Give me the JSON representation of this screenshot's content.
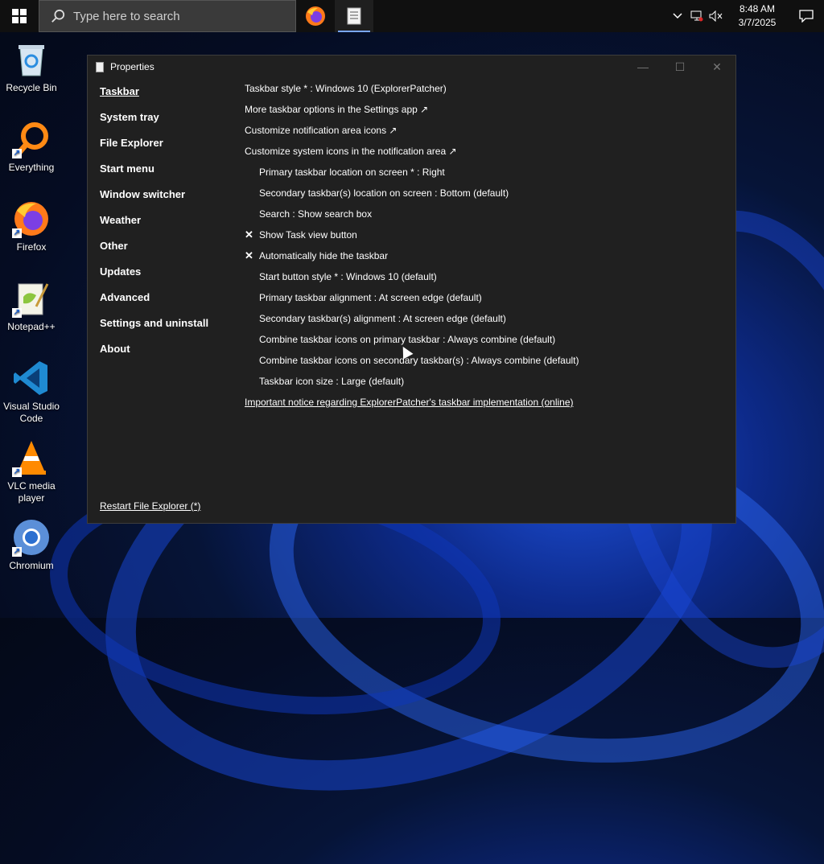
{
  "taskbar": {
    "search_placeholder": "Type here to search",
    "clock_time": "8:48 AM",
    "clock_date": "3/7/2025",
    "apps": [
      {
        "icon": "firefox-icon",
        "active": false
      },
      {
        "icon": "properties-app-icon",
        "active": true
      }
    ],
    "tray_icons": [
      "chevron-up-icon",
      "network-icon",
      "volume-muted-icon",
      "notification-icon"
    ]
  },
  "desktop": {
    "icons": [
      {
        "label": "Recycle Bin",
        "icon": "recycle-bin-icon"
      },
      {
        "label": "Everything",
        "icon": "everything-icon"
      },
      {
        "label": "Firefox",
        "icon": "firefox-icon"
      },
      {
        "label": "Notepad++",
        "icon": "notepadpp-icon"
      },
      {
        "label": "Visual Studio Code",
        "icon": "vscode-icon"
      },
      {
        "label": "VLC media player",
        "icon": "vlc-icon"
      },
      {
        "label": "Chromium",
        "icon": "chromium-icon"
      }
    ]
  },
  "window": {
    "title": "Properties",
    "nav": [
      "Taskbar",
      "System tray",
      "File Explorer",
      "Start menu",
      "Window switcher",
      "Weather",
      "Other",
      "Updates",
      "Advanced",
      "Settings and uninstall",
      "About"
    ],
    "selected_nav": "Taskbar",
    "settings": {
      "taskbar_style": "Taskbar style * : Windows 10 (ExplorerPatcher)",
      "more_options": "More taskbar options in the Settings app ↗",
      "notification_icons": "Customize notification area icons ↗",
      "system_icons": "Customize system icons in the notification area ↗",
      "primary_location": "Primary taskbar location on screen * : Right",
      "secondary_location": "Secondary taskbar(s) location on screen : Bottom (default)",
      "search": "Search : Show search box",
      "task_view": "Show Task view button",
      "auto_hide": "Automatically hide the taskbar",
      "start_button_style": "Start button style * : Windows 10 (default)",
      "primary_alignment": "Primary taskbar alignment : At screen edge (default)",
      "secondary_alignment": "Secondary taskbar(s) alignment : At screen edge (default)",
      "combine_primary": "Combine taskbar icons on primary taskbar : Always combine (default)",
      "combine_secondary": "Combine taskbar icons on secondary taskbar(s) : Always combine (default)",
      "icon_size": "Taskbar icon size : Large (default)",
      "notice_link": "Important notice regarding ExplorerPatcher's taskbar implementation (online)",
      "check_mark": "✕"
    },
    "restart_link": "Restart File Explorer (*)",
    "controls": {
      "minimize": "—",
      "maximize": "☐",
      "close": "✕"
    }
  }
}
